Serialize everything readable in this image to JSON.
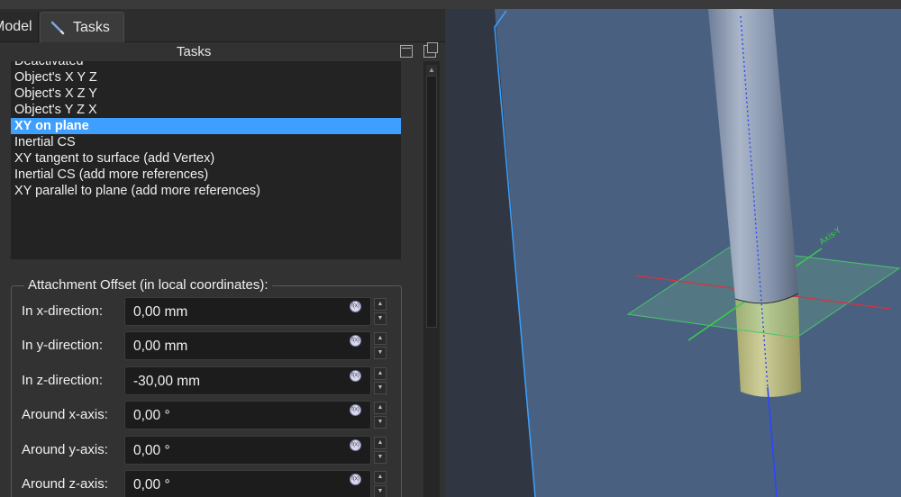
{
  "tabs": {
    "model": "Model",
    "tasks": "Tasks"
  },
  "panel": {
    "title": "Tasks"
  },
  "attachment_modes": [
    {
      "label": "Deactivated",
      "selected": false
    },
    {
      "label": "Object's X Y Z",
      "selected": false
    },
    {
      "label": "Object's X Z Y",
      "selected": false
    },
    {
      "label": "Object's Y Z X",
      "selected": false
    },
    {
      "label": "XY on plane",
      "selected": true
    },
    {
      "label": "Inertial CS",
      "selected": false
    },
    {
      "label": "XY tangent to surface (add Vertex)",
      "selected": false
    },
    {
      "label": "Inertial CS (add more references)",
      "selected": false
    },
    {
      "label": "XY parallel to plane (add more references)",
      "selected": false
    }
  ],
  "offset_group": {
    "title": "Attachment Offset (in local coordinates):",
    "rows": [
      {
        "label": "In x-direction:",
        "value": "0,00 mm"
      },
      {
        "label": "In y-direction:",
        "value": "0,00 mm"
      },
      {
        "label": "In z-direction:",
        "value": "-30,00 mm"
      },
      {
        "label": "Around x-axis:",
        "value": "0,00 °"
      },
      {
        "label": "Around y-axis:",
        "value": "0,00 °"
      },
      {
        "label": "Around z-axis:",
        "value": "0,00 °"
      }
    ]
  },
  "view3d": {
    "background_color": "#303642",
    "plane_color": "#4a6080",
    "axis_label": "Axis-Y"
  }
}
